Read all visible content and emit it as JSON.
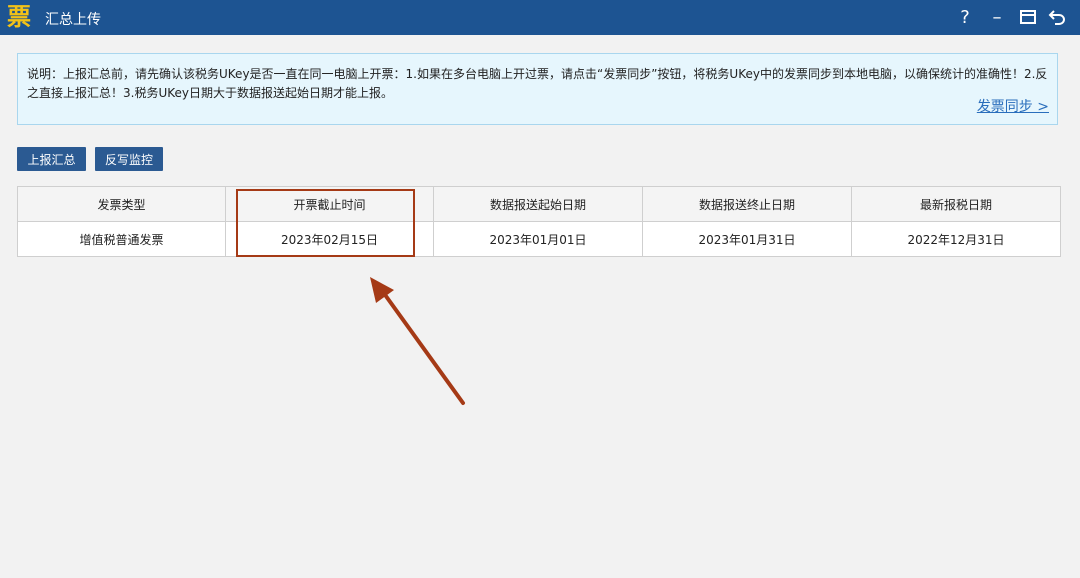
{
  "window": {
    "logo_glyph": "票",
    "title": "汇总上传",
    "help_glyph": "?",
    "minimize_glyph": "–",
    "maximize_glyph": "▣",
    "back_glyph": "⮌"
  },
  "notice": {
    "text": "说明：上报汇总前，请先确认该税务UKey是否一直在同一电脑上开票：1.如果在多台电脑上开过票，请点击“发票同步”按钮，将税务UKey中的发票同步到本地电脑，以确保统计的准确性！2.反之直接上报汇总！3.税务UKey日期大于数据报送起始日期才能上报。",
    "sync_link": "发票同步 >"
  },
  "toolbar": {
    "report_label": "上报汇总",
    "monitor_label": "反写监控"
  },
  "table": {
    "headers": [
      "发票类型",
      "开票截止时间",
      "数据报送起始日期",
      "数据报送终止日期",
      "最新报税日期"
    ],
    "rows": [
      [
        "增值税普通发票",
        "2023年02月15日",
        "2023年01月01日",
        "2023年01月31日",
        "2022年12月31日"
      ]
    ]
  },
  "colors": {
    "titlebar": "#1d5492",
    "button": "#2b5a92",
    "highlight": "#a53a16",
    "link": "#2a6ebc"
  }
}
